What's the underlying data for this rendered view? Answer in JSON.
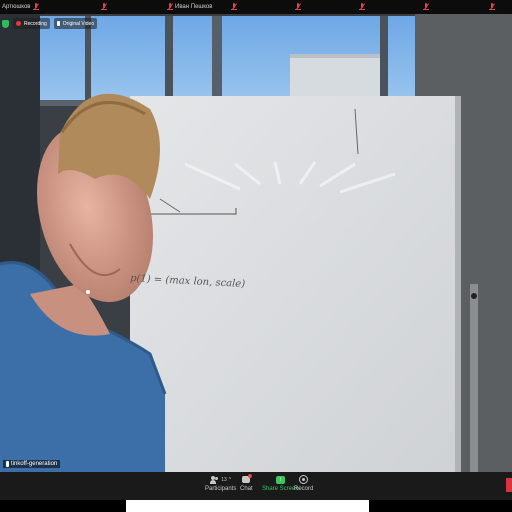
{
  "participants_strip": {
    "tiles": [
      {
        "name": "Артюшков"
      },
      {
        "name": ""
      },
      {
        "name": ""
      },
      {
        "name": ""
      },
      {
        "name": "Иван Пешков"
      },
      {
        "name": ""
      },
      {
        "name": ""
      },
      {
        "name": ""
      },
      {
        "name": ""
      }
    ]
  },
  "video": {
    "recording_label": "Recording",
    "original_video_label": "Original Video",
    "speaker_name": "tinkoff-generation",
    "whiteboard_text": "p(1) = (max lon, scale)"
  },
  "toolbar": {
    "participants_label": "Participants",
    "participants_count": "13",
    "chat_label": "Chat",
    "share_label": "Share Screen",
    "record_label": "Record"
  },
  "colors": {
    "share_green": "#3ec45e",
    "mic_muted_red": "#e64545",
    "recording_red": "#e03a3a"
  }
}
